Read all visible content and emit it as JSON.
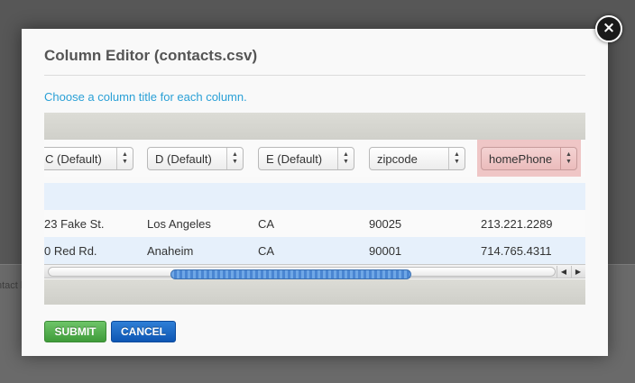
{
  "background": {
    "partial_text": "ntact l"
  },
  "modal": {
    "title": "Column Editor (contacts.csv)",
    "instructions": "Choose a column title for each column.",
    "columns": [
      {
        "selected_value": "C (Default)"
      },
      {
        "selected_value": "D (Default)"
      },
      {
        "selected_value": "E (Default)"
      },
      {
        "selected_value": "zipcode"
      },
      {
        "selected_value": "homePhone",
        "highlighted": true
      }
    ],
    "rows": [
      [
        "23 Fake St.",
        "Los Angeles",
        "CA",
        "90025",
        "213.221.2289"
      ],
      [
        "0 Red Rd.",
        "Anaheim",
        "CA",
        "90001",
        "714.765.4311"
      ]
    ],
    "scrollbar": {
      "left_arrow": "◀",
      "right_arrow": "▶"
    },
    "buttons": {
      "submit": "SUBMIT",
      "cancel": "CANCEL"
    },
    "close_symbol": "×"
  },
  "colors": {
    "instructions": "#2aa0d6",
    "submit": "#4fae4a",
    "cancel": "#1565c4",
    "highlight": "#efc6c6"
  }
}
